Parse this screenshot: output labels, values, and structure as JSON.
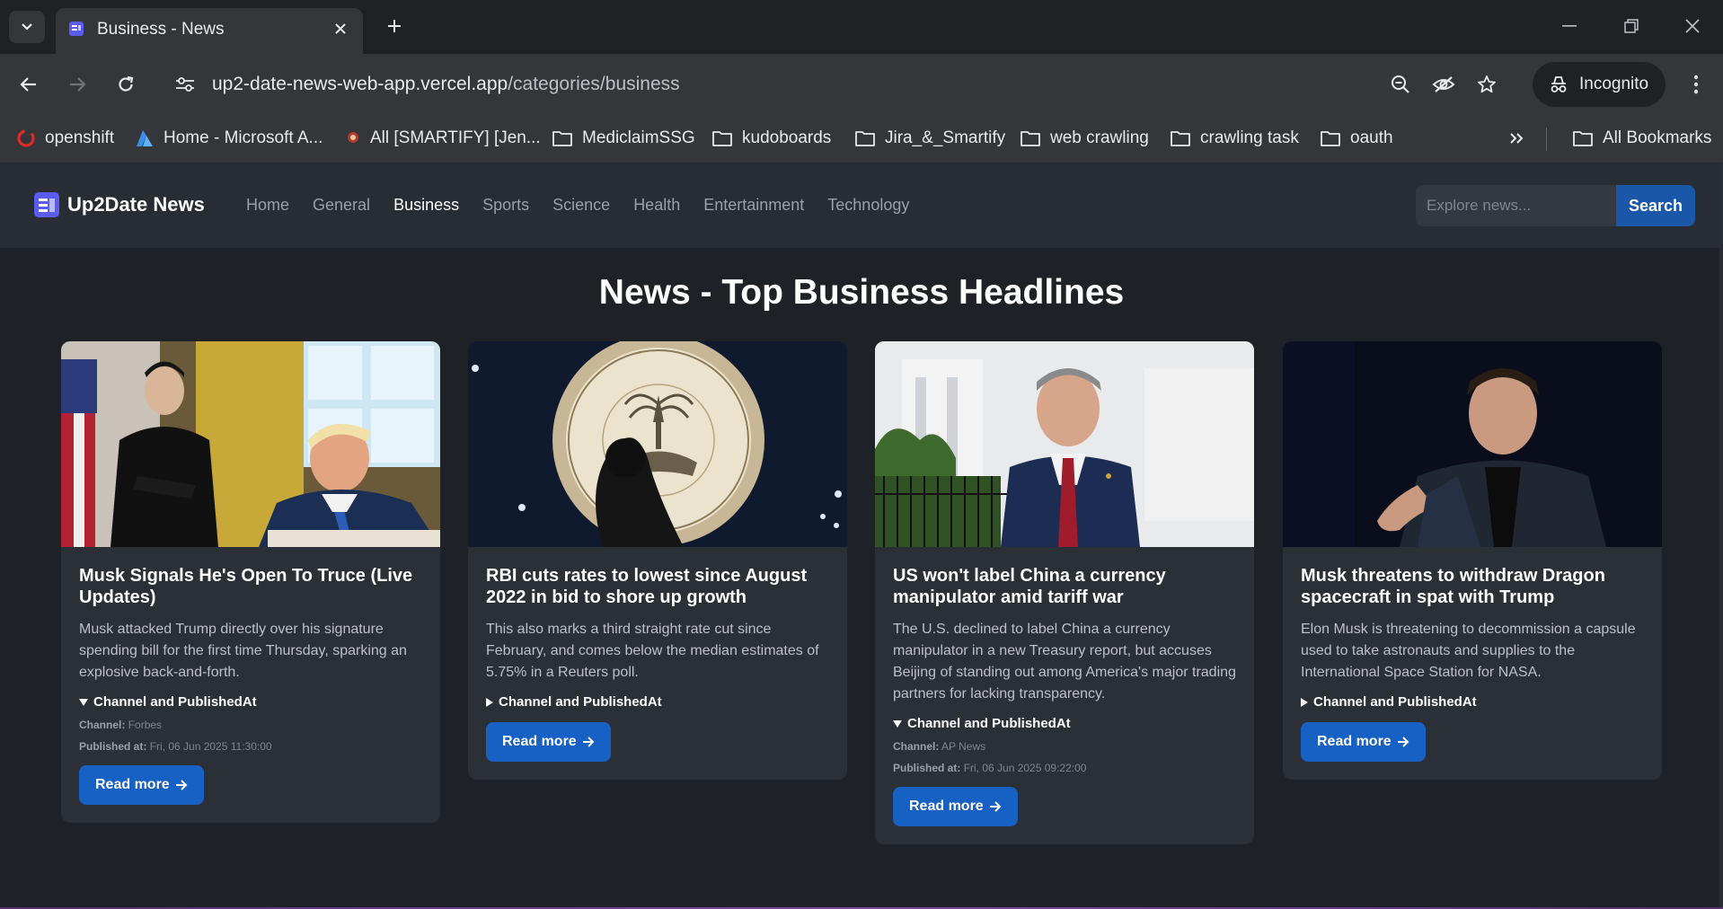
{
  "browser": {
    "tab_title": "Business - News",
    "url_host": "up2-date-news-web-app.vercel.app",
    "url_path": "/categories/business",
    "incognito_label": "Incognito",
    "bookmarks": [
      {
        "label": "openshift",
        "icon": "openshift-icon"
      },
      {
        "label": "Home - Microsoft A...",
        "icon": "azure-icon"
      },
      {
        "label": "All [SMARTIFY] [Jen...",
        "icon": "jenkins-icon"
      },
      {
        "label": "MediclaimSSG",
        "icon": "folder-icon"
      },
      {
        "label": "kudoboards",
        "icon": "folder-icon"
      },
      {
        "label": "Jira_&_Smartify",
        "icon": "folder-icon"
      },
      {
        "label": "web crawling",
        "icon": "folder-icon"
      },
      {
        "label": "crawling task",
        "icon": "folder-icon"
      },
      {
        "label": "oauth",
        "icon": "folder-icon"
      }
    ],
    "all_bookmarks_label": "All Bookmarks"
  },
  "site": {
    "logo_text": "Up2Date News",
    "nav": [
      "Home",
      "General",
      "Business",
      "Sports",
      "Science",
      "Health",
      "Entertainment",
      "Technology"
    ],
    "active_nav": "Business",
    "search_placeholder": "Explore news...",
    "search_button": "Search"
  },
  "page_heading": "News - Top Business Headlines",
  "details_label": "Channel and PublishedAt",
  "channel_label": "Channel:",
  "published_label": "Published at:",
  "read_more_label": "Read more",
  "articles": [
    {
      "title": "Musk Signals He's Open To Truce (Live Updates)",
      "description": "Musk attacked Trump directly over his signature spending bill for the first time Thursday, sparking an explosive back-and-forth.",
      "expanded": true,
      "channel": "Forbes",
      "published_at": "Fri, 06 Jun 2025 11:30:00"
    },
    {
      "title": "RBI cuts rates to lowest since August 2022 in bid to shore up growth",
      "description": "This also marks a third straight rate cut since February, and comes below the median estimates of 5.75% in a Reuters poll.",
      "expanded": false
    },
    {
      "title": "US won't label China a currency manipulator amid tariff war",
      "description": "The U.S. declined to label China a currency manipulator in a new Treasury report, but accuses Beijing of standing out among America's major trading partners for lacking transparency.",
      "expanded": true,
      "channel": "AP News",
      "published_at": "Fri, 06 Jun 2025 09:22:00"
    },
    {
      "title": "Musk threatens to withdraw Dragon spacecraft in spat with Trump",
      "description": "Elon Musk is threatening to decommission a capsule used to take astronauts and supplies to the International Space Station for NASA.",
      "expanded": false
    }
  ]
}
